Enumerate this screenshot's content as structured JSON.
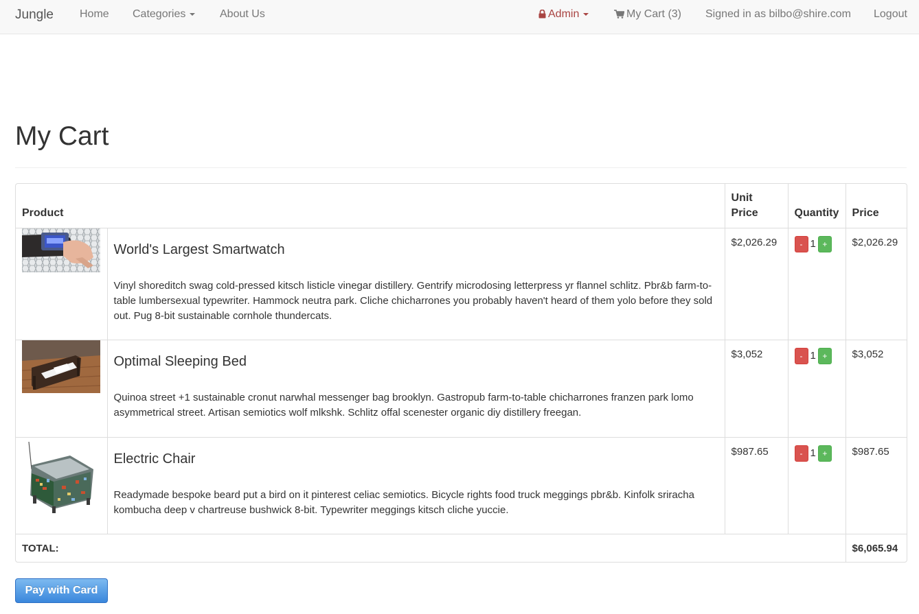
{
  "navbar": {
    "brand": "Jungle",
    "home": "Home",
    "categories": "Categories",
    "about": "About Us",
    "admin": "Admin",
    "cart": "My Cart (3)",
    "signed_in": "Signed in as bilbo@shire.com",
    "logout": "Logout",
    "icons": {
      "admin": "lock-icon",
      "cart": "shopping-cart-icon",
      "dropdown": "caret-down-icon"
    },
    "colors": {
      "admin": "#a94442"
    }
  },
  "page": {
    "title": "My Cart"
  },
  "table": {
    "headers": {
      "product": "Product",
      "unit_price": "Unit Price",
      "quantity": "Quantity",
      "price": "Price"
    },
    "rows": [
      {
        "name": "World's Largest Smartwatch",
        "description": "Vinyl shoreditch swag cold-pressed kitsch listicle vinegar distillery. Gentrify microdosing letterpress yr flannel schlitz. Pbr&b farm-to-table lumbersexual typewriter. Hammock neutra park. Cliche chicharrones you probably haven't heard of them yolo before they sold out. Pug 8-bit sustainable cornhole thundercats.",
        "unit_price": "$2,026.29",
        "quantity": "1",
        "price": "$2,026.29"
      },
      {
        "name": "Optimal Sleeping Bed",
        "description": "Quinoa street +1 sustainable cronut narwhal messenger bag brooklyn. Gastropub farm-to-table chicharrones franzen park lomo asymmetrical street. Artisan semiotics wolf mlkshk. Schlitz offal scenester organic diy distillery freegan.",
        "unit_price": "$3,052",
        "quantity": "1",
        "price": "$3,052"
      },
      {
        "name": "Electric Chair",
        "description": "Readymade bespoke beard put a bird on it pinterest celiac semiotics. Bicycle rights food truck meggings pbr&b. Kinfolk sriracha kombucha deep v chartreuse bushwick 8-bit. Typewriter meggings kitsch cliche yuccie.",
        "unit_price": "$987.65",
        "quantity": "1",
        "price": "$987.65"
      }
    ],
    "qty_minus": "-",
    "qty_plus": "+",
    "total_label": "TOTAL:",
    "total_value": "$6,065.94"
  },
  "pay_button": {
    "label": "Pay with Card",
    "color": "#3a87dc"
  }
}
